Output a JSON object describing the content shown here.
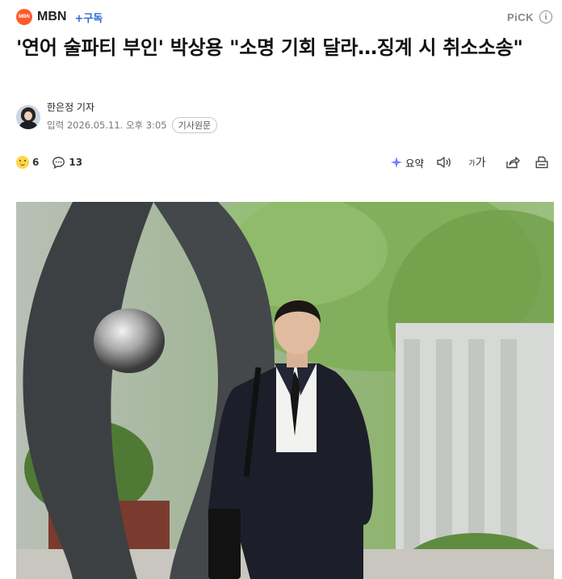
{
  "header": {
    "logo_text": "MBN",
    "press_name": "MBN",
    "subscribe_label": "+구독",
    "pick_label": "PiCK",
    "info_icon": "info-icon"
  },
  "article": {
    "title": "'연어 술파티 부인' 박상용 \"소명 기회 달라…징계 시 취소소송\"",
    "reporter": "한은정 기자",
    "date": "입력 2026.05.11. 오후 3:05",
    "original_label": "기사원문"
  },
  "actions": {
    "reaction_count": "6",
    "comment_count": "13",
    "summary_label": "요약",
    "fontsize_small": "가",
    "fontsize_large": "가"
  },
  "colors": {
    "brand": "#ff5a2b",
    "subscribe": "#2e6bd9"
  },
  "icons": [
    "reaction-icon",
    "comment-icon",
    "summary-icon",
    "speaker-icon",
    "fontsize-icon",
    "share-icon",
    "print-icon"
  ]
}
